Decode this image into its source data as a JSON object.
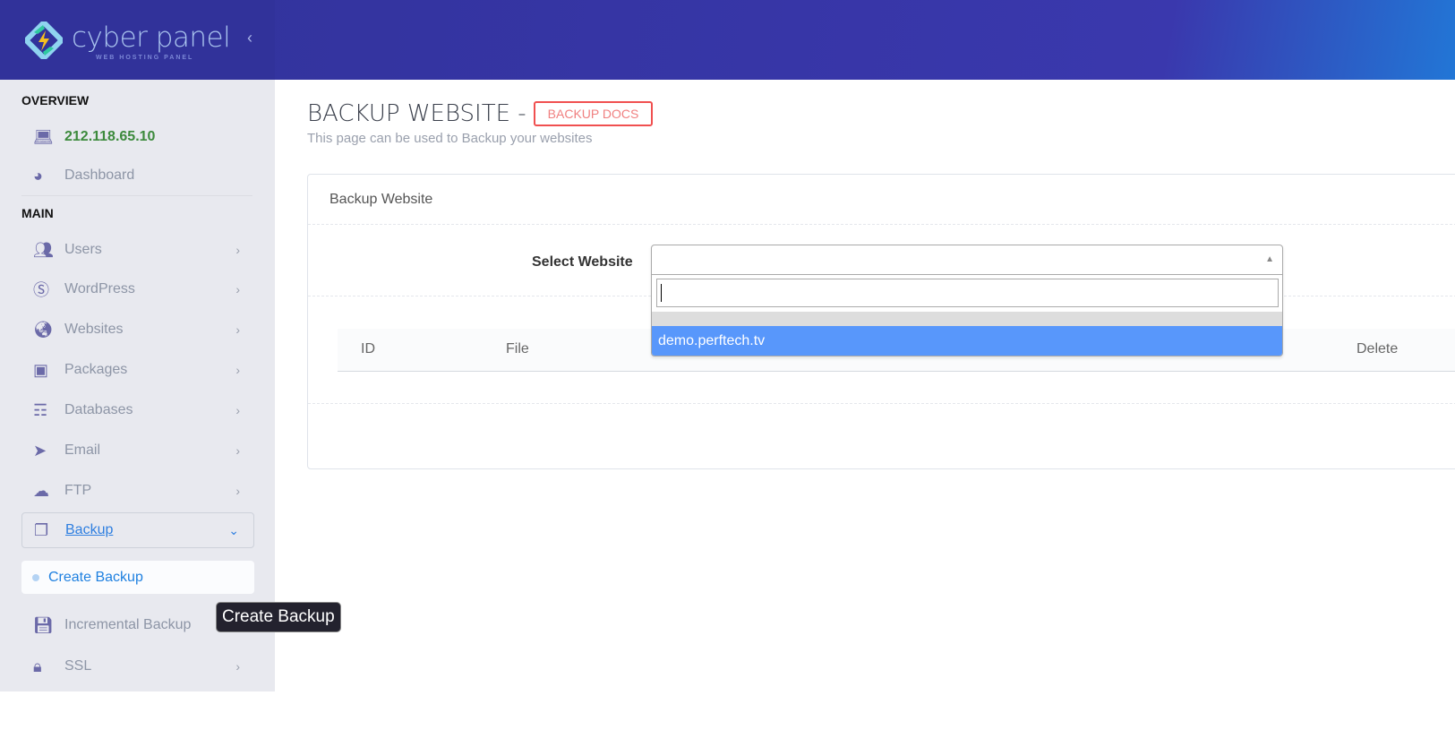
{
  "brand": {
    "name": "cyber panel",
    "tagline": "WEB HOSTING PANEL"
  },
  "sidebar": {
    "overview_label": "OVERVIEW",
    "ip": "212.118.65.10",
    "dashboard": "Dashboard",
    "main_label": "MAIN",
    "items": [
      {
        "label": "Users",
        "icon": "users-icon"
      },
      {
        "label": "WordPress",
        "icon": "wordpress-icon"
      },
      {
        "label": "Websites",
        "icon": "globe-icon"
      },
      {
        "label": "Packages",
        "icon": "cubes-icon"
      },
      {
        "label": "Databases",
        "icon": "database-icon"
      },
      {
        "label": "Email",
        "icon": "paper-plane-icon"
      },
      {
        "label": "FTP",
        "icon": "cloud-upload-icon"
      },
      {
        "label": "Backup",
        "icon": "copy-icon"
      }
    ],
    "sub_item": "Create Backup",
    "incremental": "Incremental Backup",
    "ssl": "SSL"
  },
  "tooltip": "Create Backup",
  "page": {
    "title": "BACKUP WEBSITE -",
    "docs_button": "BACKUP DOCS",
    "subtitle": "This page can be used to Backup your websites",
    "panel_title": "Backup Website",
    "select_label": "Select Website",
    "search_value": "",
    "option": "demo.perftech.tv",
    "columns": [
      "ID",
      "File",
      "Delete"
    ]
  },
  "colors": {
    "accent": "#5897fb",
    "brand": "#31329a",
    "ip": "#3c8a3c",
    "docs": "#f05050"
  }
}
